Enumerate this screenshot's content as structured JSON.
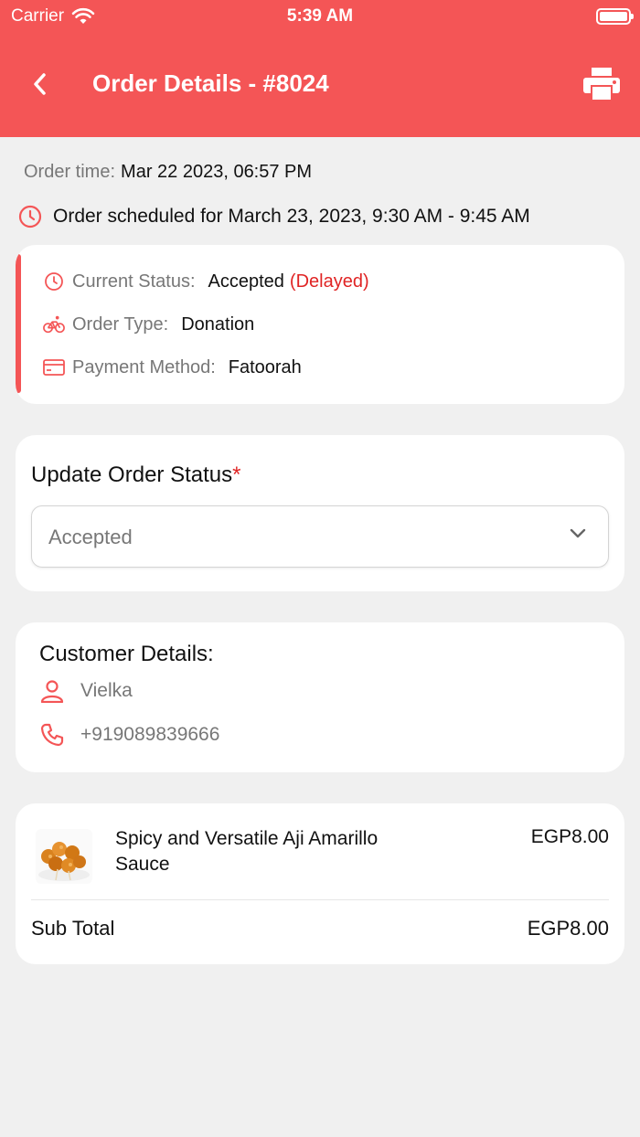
{
  "status_bar": {
    "carrier": "Carrier",
    "time": "5:39 AM"
  },
  "header": {
    "title": "Order Details - #8024",
    "back_icon": "chevron-left-icon",
    "print_icon": "printer-icon"
  },
  "order": {
    "time_label": "Order time:",
    "time_value": "Mar 22 2023, 06:57 PM",
    "scheduled_text": "Order scheduled for March 23, 2023, 9:30 AM - 9:45 AM"
  },
  "status_card": {
    "current_status_label": "Current Status:",
    "current_status_value": "Accepted",
    "delayed_text": "(Delayed)",
    "order_type_label": "Order Type:",
    "order_type_value": "Donation",
    "payment_label": "Payment Method:",
    "payment_value": "Fatoorah"
  },
  "update_status": {
    "title": "Update Order Status",
    "required_mark": "*",
    "selected": "Accepted"
  },
  "customer": {
    "title": "Customer Details:",
    "name": "Vielka",
    "phone": "+919089839666"
  },
  "items": [
    {
      "name": "Spicy and Versatile Aji Amarillo Sauce",
      "price": "EGP8.00"
    }
  ],
  "totals": {
    "subtotal_label": "Sub Total",
    "subtotal_value": "EGP8.00"
  },
  "colors": {
    "primary": "#f45556",
    "delayed": "#e02424",
    "background": "#f0f0f0"
  }
}
